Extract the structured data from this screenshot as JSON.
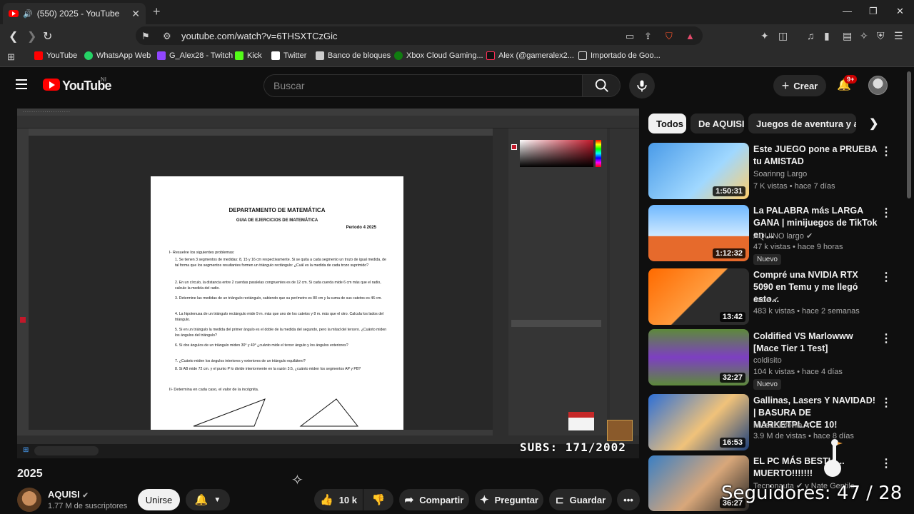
{
  "browser": {
    "tab_title": "(550) 2025 - YouTube",
    "url": "youtube.com/watch?v=6THSXTCzGic",
    "bookmarks": [
      {
        "label": "YouTube",
        "color": "#ff0000"
      },
      {
        "label": "WhatsApp Web",
        "color": "#25d366"
      },
      {
        "label": "G_Alex28 - Twitch",
        "color": "#9146ff"
      },
      {
        "label": "Kick",
        "color": "#53fc18"
      },
      {
        "label": "Twitter",
        "color": "#ffffff"
      },
      {
        "label": "Banco de bloques",
        "color": "#cccccc"
      },
      {
        "label": "Xbox Cloud Gaming...",
        "color": "#107c10"
      },
      {
        "label": "Alex (@gameralex2...",
        "color": "#111111"
      },
      {
        "label": "Importado de Goo...",
        "color": "#f5c242"
      }
    ]
  },
  "youtube": {
    "logo_text": "YouTube",
    "logo_region": "NI",
    "search_placeholder": "Buscar",
    "create_label": "Crear",
    "notif_count": "9+"
  },
  "video": {
    "title": "2025",
    "channel": "AQUISI",
    "subscribers": "1.77 M de suscriptores",
    "join_label": "Unirse",
    "likes": "10 k",
    "share_label": "Compartir",
    "ask_label": "Preguntar",
    "save_label": "Guardar",
    "overlay_subs": "SUBS: 171/2002",
    "doc": {
      "dept": "DEPARTAMENTO DE MATEMÁTICA",
      "guide": "GUIA DE EJERCICIOS DE MATEMÁTICA",
      "period": "Periodo 4 2025",
      "section1": "I-   Resuelve los siguientes problemas:",
      "questions": [
        "1. Se tienen 3 segmentos de medidas: 8, 15 y 16 cm respectivamente. Si se quita a cada segmento un trozo de igual medida, de tal forma que los segmentos resultantes formen un triángulo rectángulo: ¿Cuál es la medida de cada trozo suprimido?",
        "2. En un círculo, la distancia entre 2 cuerdas paralelas congruentes es de 12 cm. Si cada cuerda mide 6 cm más que el radio, calcule la medida del radio.",
        "3. Determine las medidas de un triángulo rectángulo, sabiendo que su perímetro es 80 cm y la suma de sus catetos es 46 cm.",
        "4. La hipotenusa de un triángulo rectángulo mide 9 m. más que uno de los catetos y 8 m. más que el otro. Calcula los lados del triángulo.",
        "5. Si en un triángulo la medida del primer ángulo es el doble de la medida del segundo, pero la mitad del tercero. ¿Cuánto miden los ángulos del triángulo?",
        "6. Si dos ángulos de un triángulo miden 30° y 40° ¿cuánto mide el tercer ángulo y los ángulos exteriores?",
        "7. ¿Cuánto miden los ángulos interiores y exteriores de un triángulo equilátero?",
        "8. Si AB mide 72 cm. y el punto P lo divide interiormente en la razón 3:5, ¿cuánto miden los segmentos AP y PB?"
      ],
      "section2": "II-   Determina en cada caso, el valor de la incógnita."
    }
  },
  "chips": [
    "Todos",
    "De AQUISI",
    "Juegos de aventura y acción"
  ],
  "recommendations": [
    {
      "title": "Este JUEGO pone a PRUEBA tu AMISTAD",
      "channel": "Soarinng Largo",
      "meta": "7 K vistas • hace 7 días",
      "duration": "1:50:31",
      "nuevo": "",
      "verified": false,
      "bg": "#4a9be8"
    },
    {
      "title": "La PALABRA más LARGA GANA | minijuegos de TikTok en ...",
      "channel": "AQUINO largo",
      "meta": "47 k vistas • hace 9 horas",
      "duration": "1:12:32",
      "nuevo": "Nuevo",
      "verified": true,
      "bg": "#6fb8ff"
    },
    {
      "title": "Compré una NVIDIA RTX 5090 en Temu y me llegó esto...",
      "channel": "Jade",
      "meta": "483 k vistas • hace 2 semanas",
      "duration": "13:42",
      "nuevo": "",
      "verified": true,
      "bg": "#ff6a00"
    },
    {
      "title": "Coldified VS Marlowww [Mace Tier 1 Test]",
      "channel": "coldisito",
      "meta": "104 k vistas • hace 4 días",
      "duration": "32:27",
      "nuevo": "Nuevo",
      "verified": false,
      "bg": "#5d8a3a"
    },
    {
      "title": "Gallinas, Lasers Y NAVIDAD! | BASURA DE MARKETPLACE 10!",
      "channel": "MissaSinfonia",
      "meta": "3.9 M de vistas • hace 8 días",
      "duration": "16:53",
      "nuevo": "",
      "verified": true,
      "bg": "#2d6fd6"
    },
    {
      "title": "EL PC MÁS BESTIA... MUERTO!!!!!!!",
      "channel": "Tecnonauta",
      "meta": "y Nate Gentile",
      "duration": "36:27",
      "nuevo": "",
      "verified": true,
      "bg": "#3a7fc4"
    }
  ],
  "overlay": {
    "followers": "Seguidores: 47 / 28"
  }
}
